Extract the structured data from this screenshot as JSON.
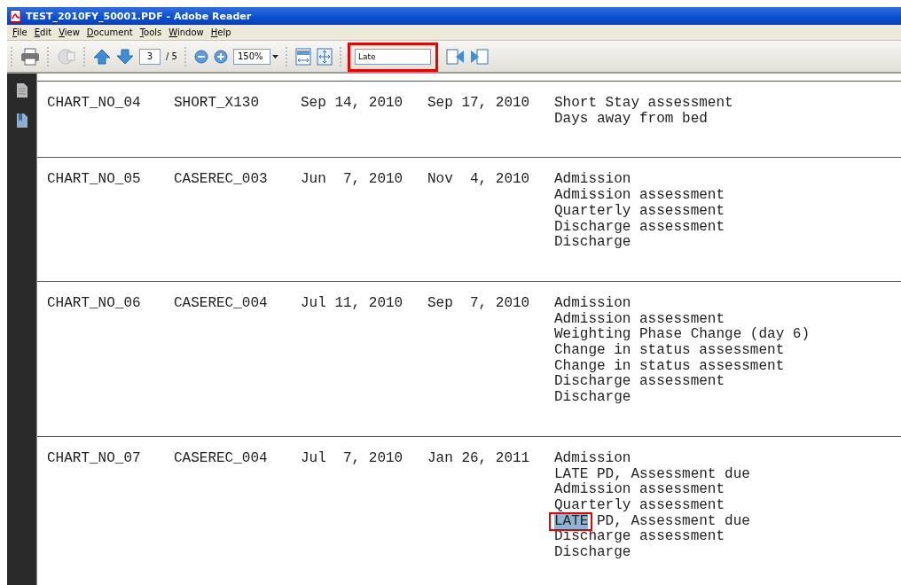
{
  "window": {
    "title": "TEST_2010FY_50001.PDF - Adobe Reader"
  },
  "menu": [
    "File",
    "Edit",
    "View",
    "Document",
    "Tools",
    "Window",
    "Help"
  ],
  "toolbar": {
    "page": "3",
    "page_total": "/ 5",
    "zoom": "150%",
    "search": {
      "value": "Late",
      "annotated": true
    }
  },
  "rows": [
    {
      "chart": "CHART_NO_04",
      "case": "SHORT_X130",
      "start": "Sep 14, 2010",
      "end": "Sep 17, 2010",
      "events": [
        {
          "text": "Short Stay assessment"
        },
        {
          "text": "Days away from bed"
        }
      ]
    },
    {
      "chart": "CHART_NO_05",
      "case": "CASEREC_003",
      "start": "Jun  7, 2010",
      "end": "Nov  4, 2010",
      "events": [
        {
          "text": "Admission"
        },
        {
          "text": "Admission assessment"
        },
        {
          "text": "Quarterly assessment"
        },
        {
          "text": "Discharge assessment"
        },
        {
          "text": "Discharge"
        }
      ]
    },
    {
      "chart": "CHART_NO_06",
      "case": "CASEREC_004",
      "start": "Jul 11, 2010",
      "end": "Sep  7, 2010",
      "events": [
        {
          "text": "Admission"
        },
        {
          "text": "Admission assessment"
        },
        {
          "text": "Weighting Phase Change (day 6)"
        },
        {
          "text": "Change in status assessment"
        },
        {
          "text": "Change in status assessment"
        },
        {
          "text": "Discharge assessment"
        },
        {
          "text": "Discharge"
        }
      ]
    },
    {
      "chart": "CHART_NO_07",
      "case": "CASEREC_004",
      "start": "Jul  7, 2010",
      "end": "Jan 26, 2011",
      "events": [
        {
          "text": "Admission"
        },
        {
          "text": "LATE PD, Assessment due"
        },
        {
          "text": "Admission assessment"
        },
        {
          "text": "Quarterly assessment"
        },
        {
          "hit": "LATE",
          "text": "PD, Assessment due",
          "annotated": true
        },
        {
          "text": "Discharge assessment"
        },
        {
          "text": "Discharge"
        }
      ]
    }
  ]
}
